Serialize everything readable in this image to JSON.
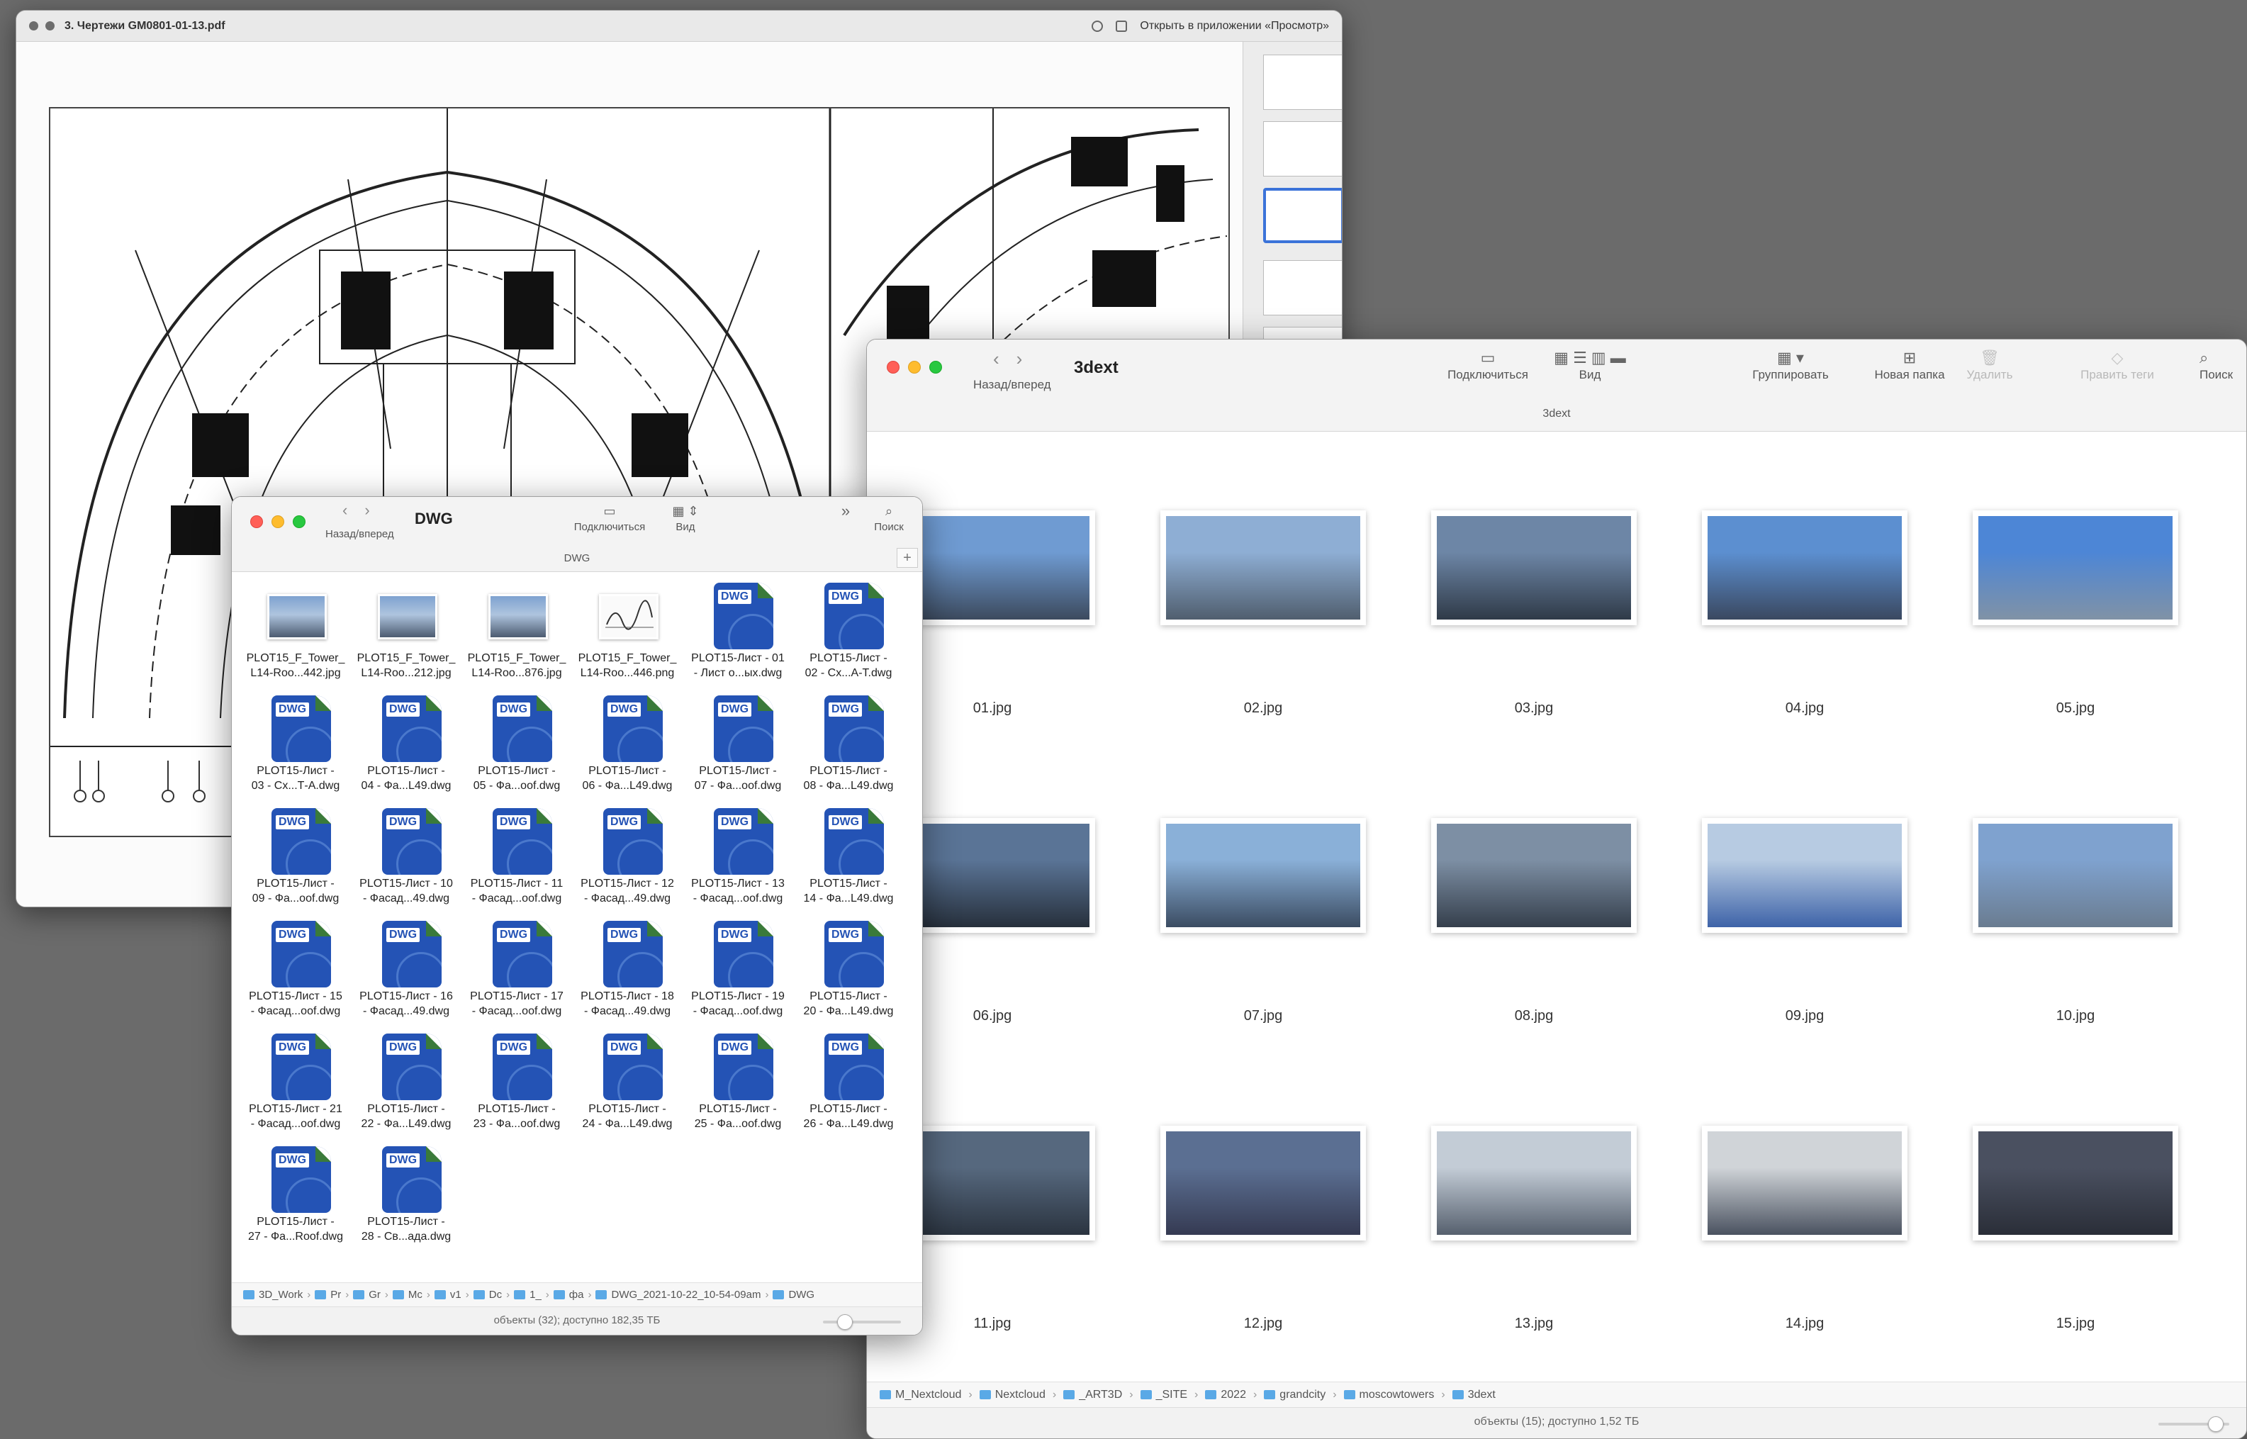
{
  "preview": {
    "title": "3. Чертежи GM0801-01-13.pdf",
    "open_in_app": "Открыть в приложении «Просмотр»"
  },
  "finder_3dext": {
    "nav_label": "Назад/вперед",
    "title": "3dext",
    "toolbar": {
      "connect": "Подключиться",
      "view": "Вид",
      "group": "Группировать",
      "new_folder": "Новая папка",
      "delete": "Удалить",
      "edit_tags": "Править теги",
      "search": "Поиск"
    },
    "path_label": "3dext",
    "files": [
      "01.jpg",
      "02.jpg",
      "03.jpg",
      "04.jpg",
      "05.jpg",
      "06.jpg",
      "07.jpg",
      "08.jpg",
      "09.jpg",
      "10.jpg",
      "11.jpg",
      "12.jpg",
      "13.jpg",
      "14.jpg",
      "15.jpg"
    ],
    "breadcrumb": [
      "M_Nextcloud",
      "Nextcloud",
      "_ART3D",
      "_SITE",
      "2022",
      "grandcity",
      "moscowtowers",
      "3dext"
    ],
    "status": "объекты (15); доступно 1,52 ТБ",
    "colors": {
      "sky": "#7fa7d6",
      "city": "#4d5b70"
    }
  },
  "finder_dwg": {
    "nav_label": "Назад/вперед",
    "title": "DWG",
    "toolbar": {
      "connect": "Подключиться",
      "view": "Вид",
      "search": "Поиск"
    },
    "path_label": "DWG",
    "files": [
      {
        "l1": "PLOT15_F_Tower_",
        "l2": "L14-Roo...442.jpg",
        "kind": "img"
      },
      {
        "l1": "PLOT15_F_Tower_",
        "l2": "L14-Roo...212.jpg",
        "kind": "img"
      },
      {
        "l1": "PLOT15_F_Tower_",
        "l2": "L14-Roo...876.jpg",
        "kind": "img"
      },
      {
        "l1": "PLOT15_F_Tower_",
        "l2": "L14-Roo...446.png",
        "kind": "sig"
      },
      {
        "l1": "PLOT15-Лист - 01",
        "l2": "- Лист о...ых.dwg",
        "kind": "dwg"
      },
      {
        "l1": "PLOT15-Лист -",
        "l2": "02 - Сх...А-Т.dwg",
        "kind": "dwg"
      },
      {
        "l1": "PLOT15-Лист -",
        "l2": "03 - Сх...Т-А.dwg",
        "kind": "dwg"
      },
      {
        "l1": "PLOT15-Лист -",
        "l2": "04 - Фа...L49.dwg",
        "kind": "dwg"
      },
      {
        "l1": "PLOT15-Лист -",
        "l2": "05 - Фа...oof.dwg",
        "kind": "dwg"
      },
      {
        "l1": "PLOT15-Лист -",
        "l2": "06 - Фа...L49.dwg",
        "kind": "dwg"
      },
      {
        "l1": "PLOT15-Лист -",
        "l2": "07 - Фа...oof.dwg",
        "kind": "dwg"
      },
      {
        "l1": "PLOT15-Лист -",
        "l2": "08 - Фа...L49.dwg",
        "kind": "dwg"
      },
      {
        "l1": "PLOT15-Лист -",
        "l2": "09 - Фа...oof.dwg",
        "kind": "dwg"
      },
      {
        "l1": "PLOT15-Лист - 10",
        "l2": "- Фасад...49.dwg",
        "kind": "dwg"
      },
      {
        "l1": "PLOT15-Лист - 11",
        "l2": "- Фасад...oof.dwg",
        "kind": "dwg"
      },
      {
        "l1": "PLOT15-Лист - 12",
        "l2": "- Фасад...49.dwg",
        "kind": "dwg"
      },
      {
        "l1": "PLOT15-Лист - 13",
        "l2": "- Фасад...oof.dwg",
        "kind": "dwg"
      },
      {
        "l1": "PLOT15-Лист -",
        "l2": "14 - Фа...L49.dwg",
        "kind": "dwg"
      },
      {
        "l1": "PLOT15-Лист - 15",
        "l2": "- Фасад...oof.dwg",
        "kind": "dwg"
      },
      {
        "l1": "PLOT15-Лист - 16",
        "l2": "- Фасад...49.dwg",
        "kind": "dwg"
      },
      {
        "l1": "PLOT15-Лист - 17",
        "l2": "- Фасад...oof.dwg",
        "kind": "dwg"
      },
      {
        "l1": "PLOT15-Лист - 18",
        "l2": "- Фасад...49.dwg",
        "kind": "dwg"
      },
      {
        "l1": "PLOT15-Лист - 19",
        "l2": "- Фасад...oof.dwg",
        "kind": "dwg"
      },
      {
        "l1": "PLOT15-Лист -",
        "l2": "20 - Фа...L49.dwg",
        "kind": "dwg"
      },
      {
        "l1": "PLOT15-Лист - 21",
        "l2": "- Фасад...oof.dwg",
        "kind": "dwg"
      },
      {
        "l1": "PLOT15-Лист -",
        "l2": "22 - Фа...L49.dwg",
        "kind": "dwg"
      },
      {
        "l1": "PLOT15-Лист -",
        "l2": "23 - Фа...oof.dwg",
        "kind": "dwg"
      },
      {
        "l1": "PLOT15-Лист -",
        "l2": "24 - Фа...L49.dwg",
        "kind": "dwg"
      },
      {
        "l1": "PLOT15-Лист -",
        "l2": "25 - Фа...oof.dwg",
        "kind": "dwg"
      },
      {
        "l1": "PLOT15-Лист -",
        "l2": "26 - Фа...L49.dwg",
        "kind": "dwg"
      },
      {
        "l1": "PLOT15-Лист -",
        "l2": "27 - Фа...Roof.dwg",
        "kind": "dwg"
      },
      {
        "l1": "PLOT15-Лист -",
        "l2": "28 - Св...ада.dwg",
        "kind": "dwg"
      }
    ],
    "dwg_badge": "DWG",
    "breadcrumb": [
      "3D_Work",
      "Pr",
      "Gr",
      "Mc",
      "v1",
      "Dc",
      "1_",
      "фа",
      "DWG_2021-10-22_10-54-09am",
      "DWG"
    ],
    "status": "объекты (32); доступно 182,35 ТБ",
    "colors": {
      "dwg_blue": "#2453b5"
    }
  }
}
